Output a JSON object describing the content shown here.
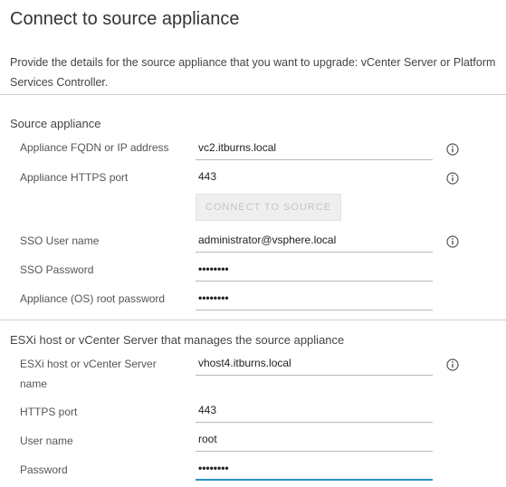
{
  "page": {
    "title": "Connect to source appliance",
    "description": "Provide the details for the source appliance that you want to upgrade: vCenter Server or Platform Services Controller."
  },
  "source_appliance": {
    "section_title": "Source appliance",
    "fqdn_label": "Appliance FQDN or IP address",
    "fqdn_value": "vc2.itburns.local",
    "https_port_label": "Appliance HTTPS port",
    "https_port_value": "443",
    "connect_button": "CONNECT TO SOURCE",
    "sso_user_label": "SSO User name",
    "sso_user_value": "administrator@vsphere.local",
    "sso_password_label": "SSO Password",
    "sso_password_value": "••••••••",
    "root_password_label": "Appliance (OS) root password",
    "root_password_value": "••••••••"
  },
  "esxi_host": {
    "section_title": "ESXi host or vCenter Server that manages the source appliance",
    "host_label": "ESXi host or vCenter Server name",
    "host_value": "vhost4.itburns.local",
    "https_port_label": "HTTPS port",
    "https_port_value": "443",
    "user_label": "User name",
    "user_value": "root",
    "password_label": "Password",
    "password_value": "••••••••"
  },
  "icons": {
    "info": "info-icon"
  },
  "colors": {
    "active_underline": "#2a92c8",
    "button_disabled_bg": "#efefef",
    "button_disabled_text": "#c4c4c4"
  }
}
